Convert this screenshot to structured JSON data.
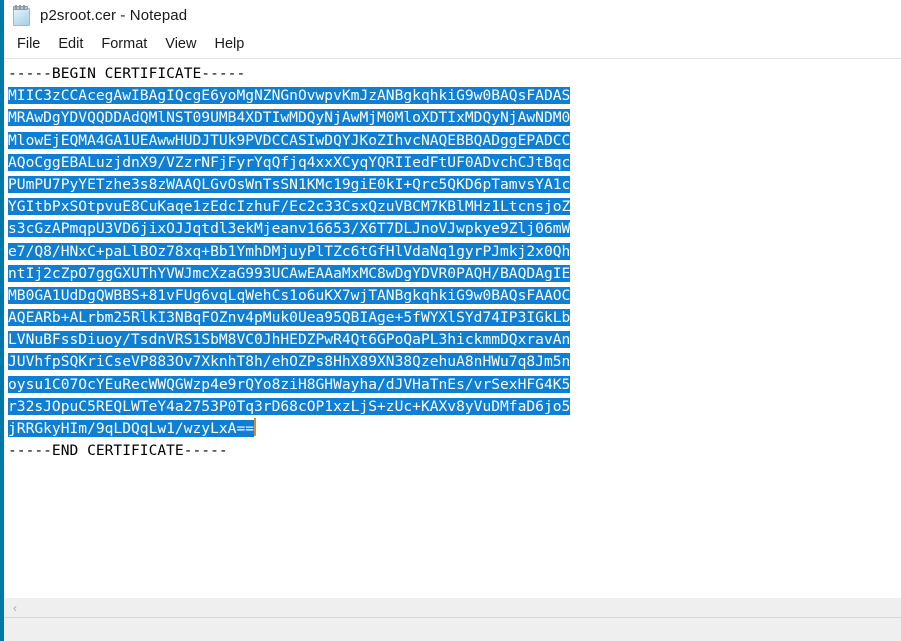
{
  "window": {
    "title": "p2sroot.cer - Notepad",
    "icon": "notepad-icon",
    "border_color": "#0078a8"
  },
  "menu": {
    "items": [
      {
        "label": "File"
      },
      {
        "label": "Edit"
      },
      {
        "label": "Format"
      },
      {
        "label": "View"
      },
      {
        "label": "Help"
      }
    ]
  },
  "editor": {
    "selection_color": "#0f7fd4",
    "selection_text_color": "#ffffff",
    "caret_color": "#d98c2b",
    "lines": [
      {
        "text": "-----BEGIN CERTIFICATE-----",
        "selected": false
      },
      {
        "text": "MIIC3zCCAcegAwIBAgIQcgE6yoMgNZNGnOvwpvKmJzANBgkqhkiG9w0BAQsFADAS",
        "selected": true
      },
      {
        "text": "MRAwDgYDVQQDDAdQMlNST09UMB4XDTIwMDQyNjAwMjM0MloXDTIxMDQyNjAwNDM0",
        "selected": true
      },
      {
        "text": "MlowEjEQMA4GA1UEAwwHUDJTUk9PVDCCASIwDQYJKoZIhvcNAQEBBQADggEPADCC",
        "selected": true
      },
      {
        "text": "AQoCggEBALuzjdnX9/VZzrNFjFyrYqQfjq4xxXCyqYQRIIedFtUF0ADvchCJtBqc",
        "selected": true
      },
      {
        "text": "PUmPU7PyYETzhe3s8zWAAQLGvOsWnTsSN1KMc19giE0kI+Qrc5QKD6pTamvsYA1c",
        "selected": true
      },
      {
        "text": "YGItbPxSOtpvuE8CuKaqe1zEdcIzhuF/Ec2c33CsxQzuVBCM7KBlMHz1LtcnsjoZ",
        "selected": true
      },
      {
        "text": "s3cGzAPmqpU3VD6jixOJJqtdl3ekMjeanv16653/X6T7DLJnoVJwpkye9Zlj06mW",
        "selected": true
      },
      {
        "text": "e7/Q8/HNxC+paLlBOz78xq+Bb1YmhDMjuyPlTZc6tGfHlVdaNq1gyrPJmkj2x0Qh",
        "selected": true
      },
      {
        "text": "ntIj2cZpO7ggGXUThYVWJmcXzaG993UCAwEAAaMxMC8wDgYDVR0PAQH/BAQDAgIE",
        "selected": true
      },
      {
        "text": "MB0GA1UdDgQWBBS+81vFUg6vqLqWehCs1o6uKX7wjTANBgkqhkiG9w0BAQsFAAOC",
        "selected": true
      },
      {
        "text": "AQEARb+ALrbm25RlkI3NBqFOZnv4pMuk0Uea95QBIAge+5fWYXlSYd74IP3IGkLb",
        "selected": true
      },
      {
        "text": "LVNuBFssDiuoy/TsdnVRS1SbM8VC0JhHEDZPwR4Qt6GPoQaPL3hickmmDQxravAn",
        "selected": true
      },
      {
        "text": "JUVhfpSQKriCseVP883Ov7XknhT8h/ehOZPs8HhX89XN38QzehuA8nHWu7q8Jm5n",
        "selected": true
      },
      {
        "text": "oysu1C07OcYEuRecWWQGWzp4e9rQYo8ziH8GHWayha/dJVHaTnEs/vrSexHFG4K5",
        "selected": true
      },
      {
        "text": "r32sJOpuC5REQLWTeY4a2753P0Tq3rD68cOP1xzLjS+zUc+KAXv8yVuDMfaD6jo5",
        "selected": true
      },
      {
        "text": "jRRGkyHIm/9qLDQqLw1/wzyLxA==",
        "selected": true,
        "caret_after": true
      },
      {
        "text": "-----END CERTIFICATE-----",
        "selected": false
      }
    ]
  },
  "scrollbar": {
    "left_arrow_glyph": "‹",
    "right_arrow_glyph": "›"
  },
  "status_bar": {
    "text": ""
  }
}
